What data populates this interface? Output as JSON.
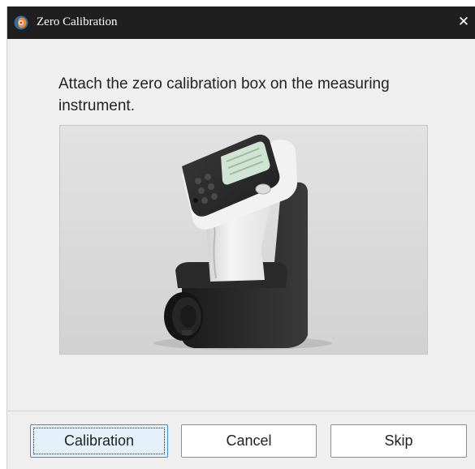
{
  "dialog": {
    "title": "Zero Calibration",
    "close_icon": "close-icon",
    "app_icon": "app-logo-icon"
  },
  "content": {
    "instruction": "Attach the zero calibration box on the measuring instrument.",
    "image_subject": "colorimeter-with-zero-calibration-box"
  },
  "buttons": {
    "calibration_label": "Calibration",
    "cancel_label": "Cancel",
    "skip_label": "Skip"
  },
  "colors": {
    "titlebar": "#1f1f1f",
    "dialog_bg": "#efefef",
    "default_button_bg": "#e4f1fa",
    "default_button_border": "#3e8ec9"
  }
}
